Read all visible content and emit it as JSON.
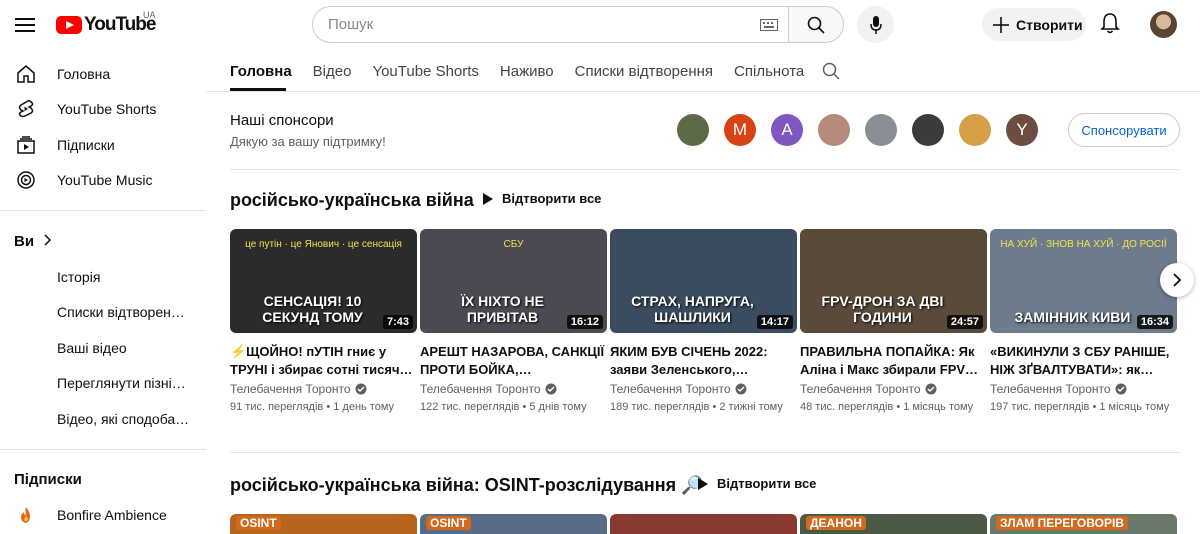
{
  "header": {
    "logo_text": "YouTube",
    "country_code": "UA",
    "search_placeholder": "Пошук",
    "create_label": "Створити"
  },
  "sidebar": {
    "main": [
      {
        "label": "Головна",
        "icon": "home-icon"
      },
      {
        "label": "YouTube Shorts",
        "icon": "shorts-icon"
      },
      {
        "label": "Підписки",
        "icon": "subscriptions-icon"
      },
      {
        "label": "YouTube Music",
        "icon": "music-icon"
      }
    ],
    "you_heading": "Ви",
    "you_items": [
      "Історія",
      "Списки відтворен…",
      "Ваші відео",
      "Переглянути пізні…",
      "Відео, які сподоба…"
    ],
    "subs_heading": "Підписки",
    "subs_items": [
      {
        "label": "Bonfire Ambience"
      }
    ]
  },
  "tabs": [
    "Головна",
    "Відео",
    "YouTube Shorts",
    "Наживо",
    "Списки відтворення",
    "Спільнота"
  ],
  "sponsors": {
    "title": "Наші спонсори",
    "subtitle": "Дякую за вашу підтримку!",
    "avatars": [
      {
        "letter": "",
        "color": "#5b6b4a"
      },
      {
        "letter": "M",
        "color": "#d84315"
      },
      {
        "letter": "A",
        "color": "#7e57c2"
      },
      {
        "letter": "",
        "color": "#b58a7a"
      },
      {
        "letter": "",
        "color": "#8a8f95"
      },
      {
        "letter": "",
        "color": "#3b3b3b"
      },
      {
        "letter": "",
        "color": "#d7a046"
      },
      {
        "letter": "Y",
        "color": "#6d4c41"
      }
    ],
    "button_label": "Спонсорувати"
  },
  "shelf1": {
    "title": "російсько-українська війна",
    "play_all": "Відтворити все",
    "videos": [
      {
        "thumb_text": "СЕНСАЦІЯ! 10 СЕКУНД ТОМУ",
        "thumb_sub": "це путін · це Янович · це сенсація",
        "thumb_bg": "#2b2b2b",
        "duration": "7:43",
        "title": "⚡ЩОЙНО! пУТІН гниє у ТРУНІ і збирає сотні тисяч…",
        "channel": "Телебачення Торонто",
        "views": "91 тис. переглядів",
        "age": "1 день тому"
      },
      {
        "thumb_text": "ЇХ НІХТО НЕ ПРИВІТАВ",
        "thumb_sub": "СБУ",
        "thumb_bg": "#4a4a52",
        "duration": "16:12",
        "title": "АРЕШТ НАЗАРОВА, САНКЦІЇ ПРОТИ БОЙКА,…",
        "channel": "Телебачення Торонто",
        "views": "122 тис. переглядів",
        "age": "5 днів тому"
      },
      {
        "thumb_text": "СТРАХ, НАПРУГА, ШАШЛИКИ",
        "thumb_sub": "",
        "thumb_bg": "#3b4b60",
        "duration": "14:17",
        "title": "ЯКИМ БУВ СІЧЕНЬ 2022: заяви Зеленського,…",
        "channel": "Телебачення Торонто",
        "views": "189 тис. переглядів",
        "age": "2 тижні тому"
      },
      {
        "thumb_text": "FPV-ДРОН ЗА ДВІ ГОДИНИ",
        "thumb_sub": "",
        "thumb_bg": "#5a4a3c",
        "duration": "24:57",
        "title": "ПРАВИЛЬНА ПОПАЙКА: Як Аліна і Макс збирали FPV…",
        "channel": "Телебачення Торонто",
        "views": "48 тис. переглядів",
        "age": "1 місяць тому"
      },
      {
        "thumb_text": "ЗАМІННИК КИВИ",
        "thumb_sub": "НА ХУЙ · ЗНОВ НА ХУЙ · ДО РОСІЇ",
        "thumb_bg": "#6c7c8c",
        "duration": "16:34",
        "title": "«ВИКИНУЛИ З СБУ РАНІШЕ, НІЖ ЗҐВАЛТУВАТИ»: як…",
        "channel": "Телебачення Торонто",
        "views": "197 тис. переглядів",
        "age": "1 місяць тому"
      }
    ]
  },
  "shelf2": {
    "title": "російсько-українська війна: OSINT-розслідування 🔎",
    "play_all": "Відтворити все",
    "thumbs": [
      {
        "label": "OSINT",
        "bg": "#b5651d"
      },
      {
        "label": "OSINT",
        "bg": "#5a6b85"
      },
      {
        "label": "",
        "bg": "#8a3a30"
      },
      {
        "label": "ДЕАНОН",
        "bg": "#4b5a45"
      },
      {
        "label": "ЗЛАМ ПЕРЕГОВОРІВ",
        "bg": "#6a7a6a"
      }
    ]
  }
}
